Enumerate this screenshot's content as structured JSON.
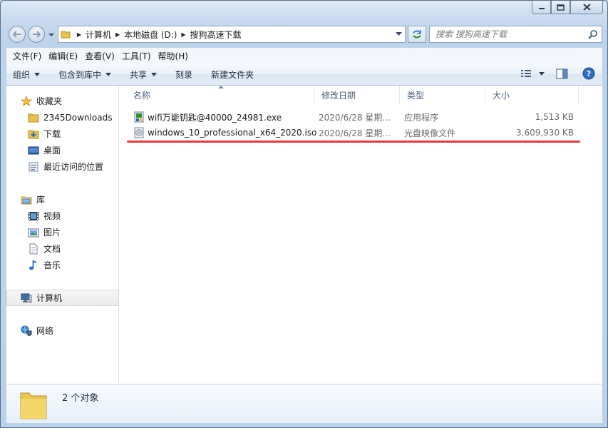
{
  "window": {
    "caption_buttons": [
      "minimize",
      "maximize",
      "close"
    ]
  },
  "address": {
    "segments": [
      "计算机",
      "本地磁盘 (D:)",
      "搜狗高速下载"
    ]
  },
  "search": {
    "placeholder": "搜索 搜狗高速下载"
  },
  "menubar": {
    "items": [
      "文件(F)",
      "编辑(E)",
      "查看(V)",
      "工具(T)",
      "帮助(H)"
    ]
  },
  "toolbar": {
    "organize": "组织",
    "include_in_library": "包含到库中",
    "share": "共享",
    "burn": "刻录",
    "new_folder": "新建文件夹"
  },
  "sidebar": {
    "favorites": {
      "label": "收藏夹",
      "items": [
        "2345Downloads",
        "下载",
        "桌面",
        "最近访问的位置"
      ]
    },
    "libraries": {
      "label": "库",
      "items": [
        "视频",
        "图片",
        "文档",
        "音乐"
      ]
    },
    "computer": "计算机",
    "network": "网络"
  },
  "columns": {
    "name": "名称",
    "date": "修改日期",
    "type": "类型",
    "size": "大小"
  },
  "files": [
    {
      "name": "wifi万能钥匙@40000_24981.exe",
      "date": "2020/6/28 星期...",
      "type": "应用程序",
      "size": "1,513 KB",
      "icon": "exe-icon"
    },
    {
      "name": "windows_10_professional_x64_2020.iso",
      "date": "2020/6/28 星期...",
      "type": "光盘映像文件",
      "size": "3,609,930 KB",
      "icon": "iso-icon"
    }
  ],
  "annotation": {
    "underline_color": "#e53a35"
  },
  "status": {
    "count": "2 个对象"
  }
}
